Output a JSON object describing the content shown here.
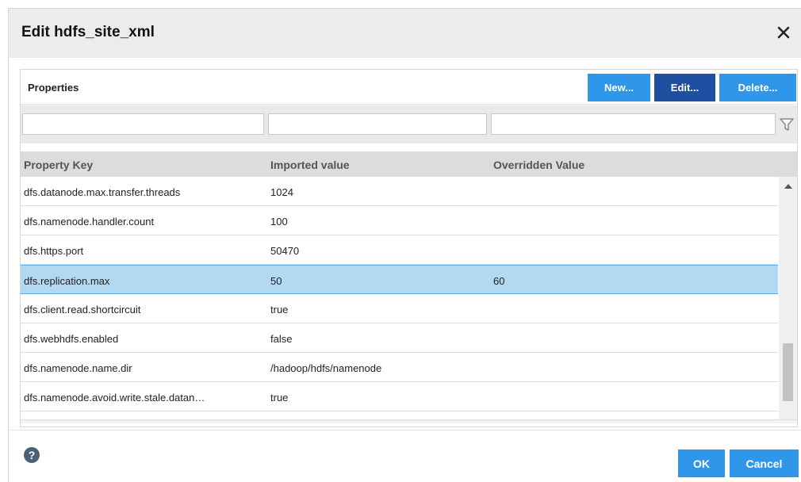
{
  "dialog": {
    "title": "Edit hdfs_site_xml"
  },
  "panel": {
    "title": "Properties",
    "buttons": {
      "new": "New...",
      "edit": "Edit...",
      "delete": "Delete..."
    }
  },
  "table": {
    "columns": [
      "Property Key",
      "Imported value",
      "Overridden Value"
    ],
    "rows": [
      {
        "key": "dfs.datanode.max.transfer.threads",
        "imported": "1024",
        "overridden": "",
        "selected": false
      },
      {
        "key": "dfs.namenode.handler.count",
        "imported": "100",
        "overridden": "",
        "selected": false
      },
      {
        "key": "dfs.https.port",
        "imported": "50470",
        "overridden": "",
        "selected": false
      },
      {
        "key": "dfs.replication.max",
        "imported": "50",
        "overridden": "60",
        "selected": true
      },
      {
        "key": "dfs.client.read.shortcircuit",
        "imported": "true",
        "overridden": "",
        "selected": false
      },
      {
        "key": "dfs.webhdfs.enabled",
        "imported": "false",
        "overridden": "",
        "selected": false
      },
      {
        "key": "dfs.namenode.name.dir",
        "imported": "/hadoop/hdfs/namenode",
        "overridden": "",
        "selected": false
      },
      {
        "key": "dfs.namenode.avoid.write.stale.datan…",
        "imported": "true",
        "overridden": "",
        "selected": false
      }
    ]
  },
  "footer": {
    "ok": "OK",
    "cancel": "Cancel"
  },
  "icons": {
    "close": "close-icon",
    "filter": "filter-funnel-icon",
    "help": "help-icon",
    "scroll_up": "scroll-up-arrow-icon"
  },
  "colors": {
    "primary_button": "#2f97ea",
    "active_button": "#1f4fa0",
    "selected_row": "#b3d8f2"
  }
}
